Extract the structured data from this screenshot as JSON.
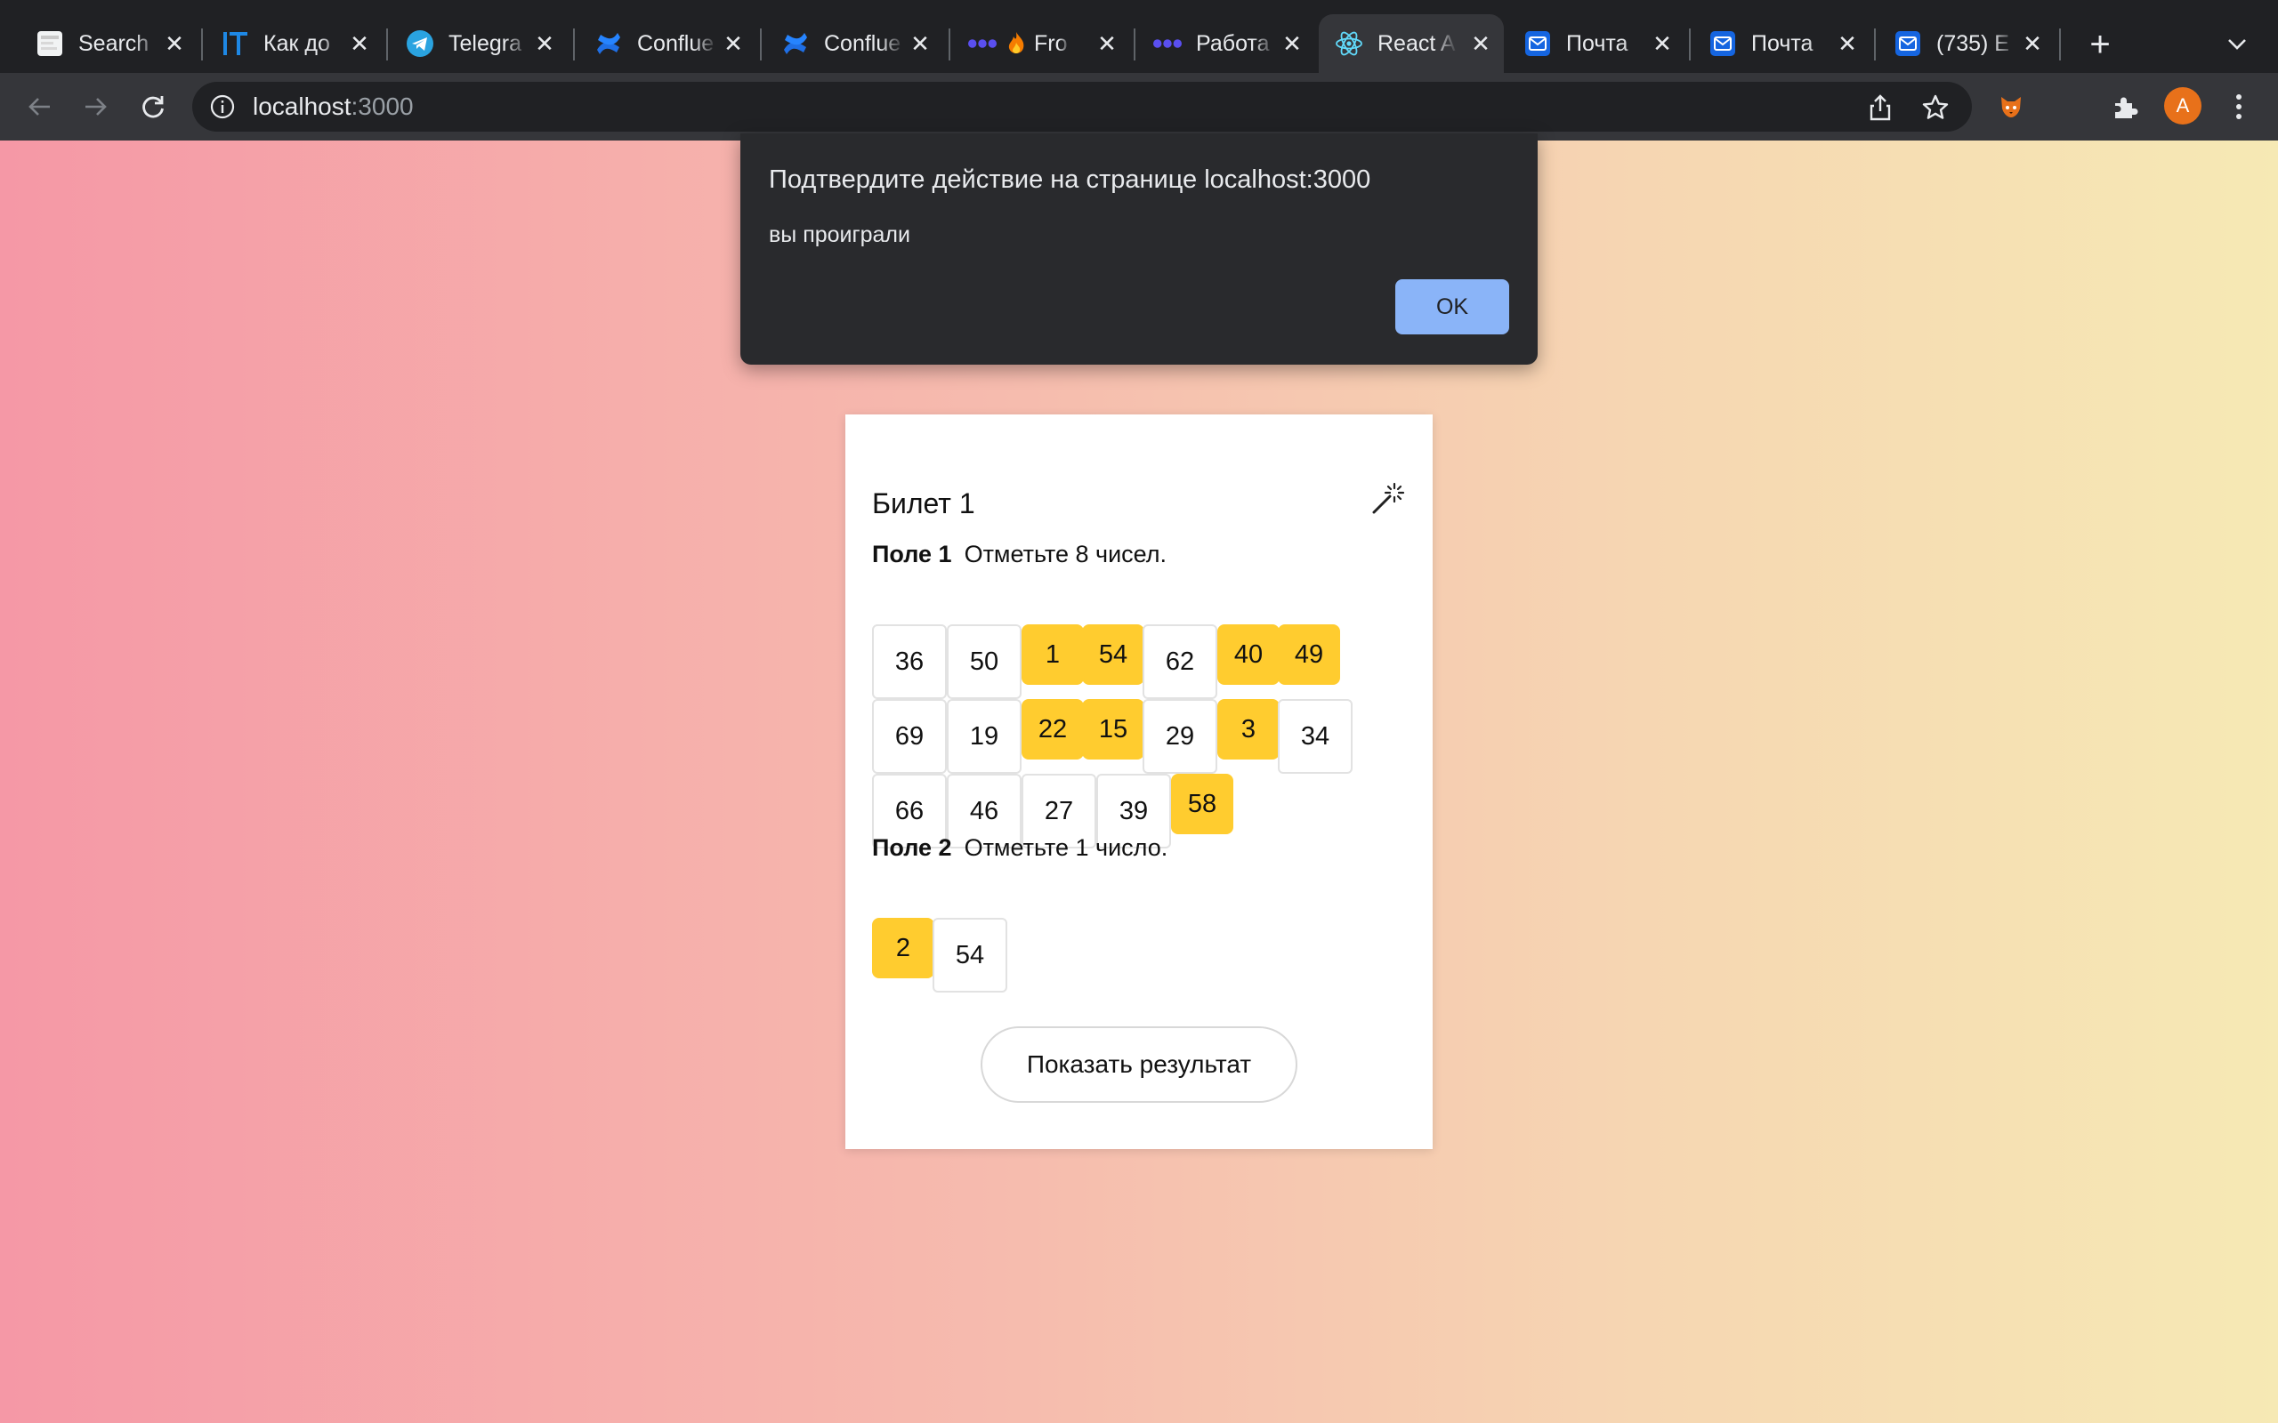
{
  "browser": {
    "tabs": [
      {
        "title": "Search",
        "icon": "search-favicon-icon"
      },
      {
        "title": "Как до",
        "icon": "it-favicon-icon"
      },
      {
        "title": "Telegra",
        "icon": "telegram-icon"
      },
      {
        "title": "Conflue",
        "icon": "confluence-icon"
      },
      {
        "title": "Conflue",
        "icon": "confluence-icon"
      },
      {
        "title": "Fro",
        "icon": "dots-icon"
      },
      {
        "title": "Работа",
        "icon": "dots-icon"
      },
      {
        "title": "React A",
        "icon": "react-icon",
        "active": true
      },
      {
        "title": "Почта",
        "icon": "mail-icon"
      },
      {
        "title": "Почта",
        "icon": "mail-icon"
      },
      {
        "title": "(735) E",
        "icon": "mail-icon"
      }
    ],
    "address": {
      "host": "localhost",
      "port": ":3000"
    },
    "profile_initial": "A",
    "colors": {
      "tabstrip": "#202124",
      "toolbar": "#35363a",
      "accent": "#8ab4f8"
    }
  },
  "dialog": {
    "title": "Подтвердите действие на странице localhost:3000",
    "message": "вы проиграли",
    "ok_label": "OK"
  },
  "ticket": {
    "title": "Билет 1",
    "field1": {
      "label": "Поле 1",
      "instruction": "Отметьте 8 чисел.",
      "numbers": [
        {
          "n": "36",
          "selected": false
        },
        {
          "n": "50",
          "selected": false
        },
        {
          "n": "1",
          "selected": true
        },
        {
          "n": "54",
          "selected": true
        },
        {
          "n": "62",
          "selected": false
        },
        {
          "n": "40",
          "selected": true
        },
        {
          "n": "49",
          "selected": true
        },
        {
          "n": "69",
          "selected": false
        },
        {
          "n": "19",
          "selected": false
        },
        {
          "n": "22",
          "selected": true
        },
        {
          "n": "15",
          "selected": true
        },
        {
          "n": "29",
          "selected": false
        },
        {
          "n": "3",
          "selected": true
        },
        {
          "n": "34",
          "selected": false
        },
        {
          "n": "66",
          "selected": false
        },
        {
          "n": "46",
          "selected": false
        },
        {
          "n": "27",
          "selected": false
        },
        {
          "n": "39",
          "selected": false
        },
        {
          "n": "58",
          "selected": true
        }
      ]
    },
    "field2": {
      "label": "Поле 2",
      "instruction": "Отметьте 1 число.",
      "numbers": [
        {
          "n": "2",
          "selected": true
        },
        {
          "n": "54",
          "selected": false
        }
      ]
    },
    "result_button": "Показать результат",
    "colors": {
      "selected": "#ffcc2f",
      "cell_border": "#e2e2e2"
    }
  }
}
